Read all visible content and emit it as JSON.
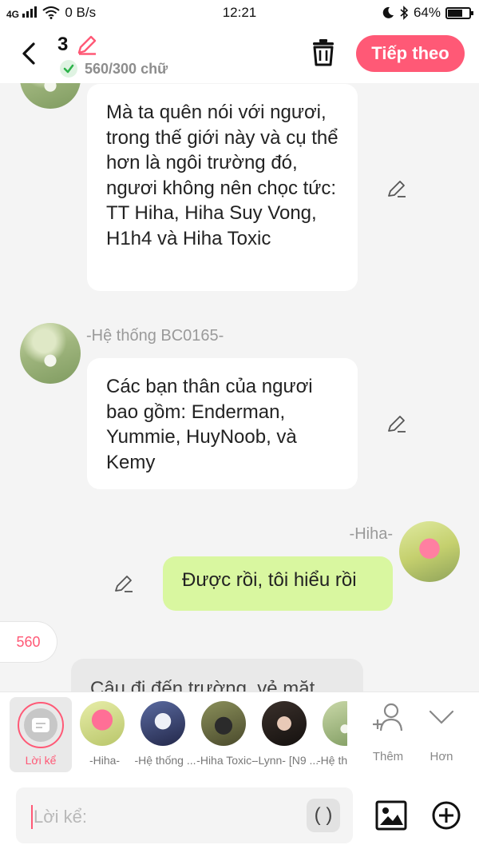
{
  "status_bar": {
    "network": "4G",
    "speed": "0 B/s",
    "time": "12:21",
    "battery_percent": "64%",
    "battery_level": 0.64
  },
  "header": {
    "chapter_number": "3",
    "word_count": "560/300 chữ",
    "next_label": "Tiếp theo",
    "accent_color": "#ff5976"
  },
  "messages": [
    {
      "sender": "",
      "text": "Mà ta quên nói với ngươi, trong thế giới này và cụ thể hơn là ngôi trường đó, ngươi không nên chọc tức: TT Hiha, Hiha Suy Vong, H1h4 và Hiha Toxic"
    },
    {
      "sender": "-Hệ thống BC0165-",
      "text": "Các bạn thân của ngươi bao gồm: Enderman, Yummie, HuyNoob, và Kemy"
    },
    {
      "sender": "-Hiha-",
      "text": "Được rồi, tôi hiểu rồi"
    },
    {
      "sender": "",
      "text": "Cậu đi đến trường, vẻ mặt"
    }
  ],
  "count_badge": "560",
  "characters": {
    "narrator_label": "Lời kể",
    "items": [
      {
        "name": "-Hiha-"
      },
      {
        "name": "-Hệ thống ..."
      },
      {
        "name": "-Hiha Toxic-"
      },
      {
        "name": "-Lynn- [N9 ..."
      },
      {
        "name": "-Hệ th"
      }
    ],
    "add_label": "Thêm",
    "more_label": "Hơn"
  },
  "composer": {
    "placeholder": "Lời kể:",
    "paren_label": "( )"
  }
}
